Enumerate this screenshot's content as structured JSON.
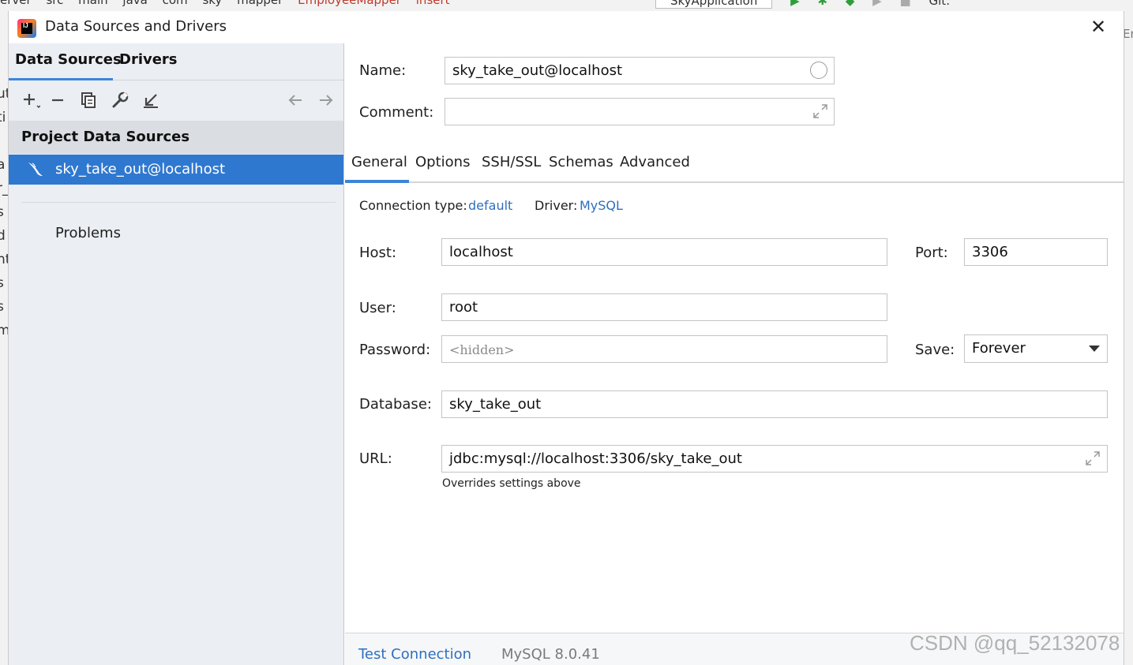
{
  "ide": {
    "breadcrumbs": [
      "erver",
      "src",
      "main",
      "java",
      "com",
      "sky",
      "mapper",
      "EmployeeMapper",
      "insert"
    ],
    "run_config": "SkyApplication",
    "git_label": "Git:",
    "left_fragments": [
      "ut",
      "ti",
      "a",
      "r_",
      "s",
      "d",
      "nt",
      "s",
      "s",
      "m"
    ],
    "right_fragment": "Em"
  },
  "dialog": {
    "title": "Data Sources and Drivers",
    "close_label": "✕"
  },
  "left": {
    "tabs": [
      "Data Sources",
      "Drivers"
    ],
    "group_header": "Project Data Sources",
    "selected_item": "sky_take_out@localhost",
    "problems_label": "Problems"
  },
  "form": {
    "name_label": "Name:",
    "name_value": "sky_take_out@localhost",
    "comment_label": "Comment:",
    "comment_value": "",
    "tabs": [
      "General",
      "Options",
      "SSH/SSL",
      "Schemas",
      "Advanced"
    ],
    "connection_type_label": "Connection type:",
    "connection_type_value": "default",
    "driver_label": "Driver:",
    "driver_value": "MySQL",
    "host_label": "Host:",
    "host_value": "localhost",
    "port_label": "Port:",
    "port_value": "3306",
    "user_label": "User:",
    "user_value": "root",
    "password_label": "Password:",
    "password_placeholder": "<hidden>",
    "save_label": "Save:",
    "save_value": "Forever",
    "database_label": "Database:",
    "database_value": "sky_take_out",
    "url_label": "URL:",
    "url_value": "jdbc:mysql://localhost:3306/sky_take_out",
    "url_hint": "Overrides settings above"
  },
  "footer": {
    "test_connection": "Test Connection",
    "version": "MySQL 8.0.41"
  },
  "watermark": "CSDN @qq_52132078",
  "colors": {
    "accent": "#3c85d7",
    "selection": "#2f78d0",
    "link": "#2f6fbf",
    "left_panel_bg": "#ebeef2"
  }
}
